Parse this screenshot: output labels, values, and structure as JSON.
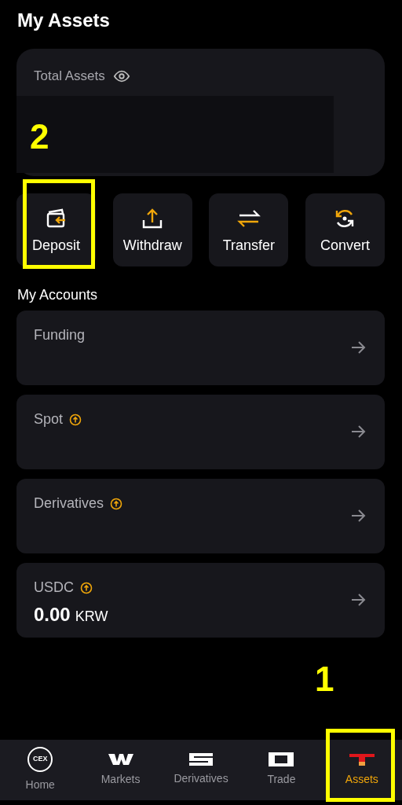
{
  "header": {
    "title": "My Assets"
  },
  "total_assets": {
    "label": "Total Assets"
  },
  "actions": [
    {
      "kind": "deposit",
      "label": "Deposit"
    },
    {
      "kind": "withdraw",
      "label": "Withdraw"
    },
    {
      "kind": "transfer",
      "label": "Transfer"
    },
    {
      "kind": "convert",
      "label": "Convert"
    }
  ],
  "accounts_heading": "My Accounts",
  "accounts": [
    {
      "name": "Funding",
      "upgrade_badge": false
    },
    {
      "name": "Spot",
      "upgrade_badge": true
    },
    {
      "name": "Derivatives",
      "upgrade_badge": true
    },
    {
      "name": "USDC",
      "upgrade_badge": true,
      "amount": "0.00",
      "currency": "KRW"
    }
  ],
  "nav": [
    {
      "kind": "home",
      "label": "Home",
      "icon_text": "CEX",
      "selected": false
    },
    {
      "kind": "markets",
      "label": "Markets",
      "selected": false
    },
    {
      "kind": "derivatives",
      "label": "Derivatives",
      "selected": false
    },
    {
      "kind": "trade",
      "label": "Trade",
      "selected": false
    },
    {
      "kind": "assets",
      "label": "Assets",
      "selected": true
    }
  ],
  "annotations": [
    {
      "kind": "nav",
      "number": "1"
    },
    {
      "kind": "actions",
      "number": "2"
    }
  ]
}
